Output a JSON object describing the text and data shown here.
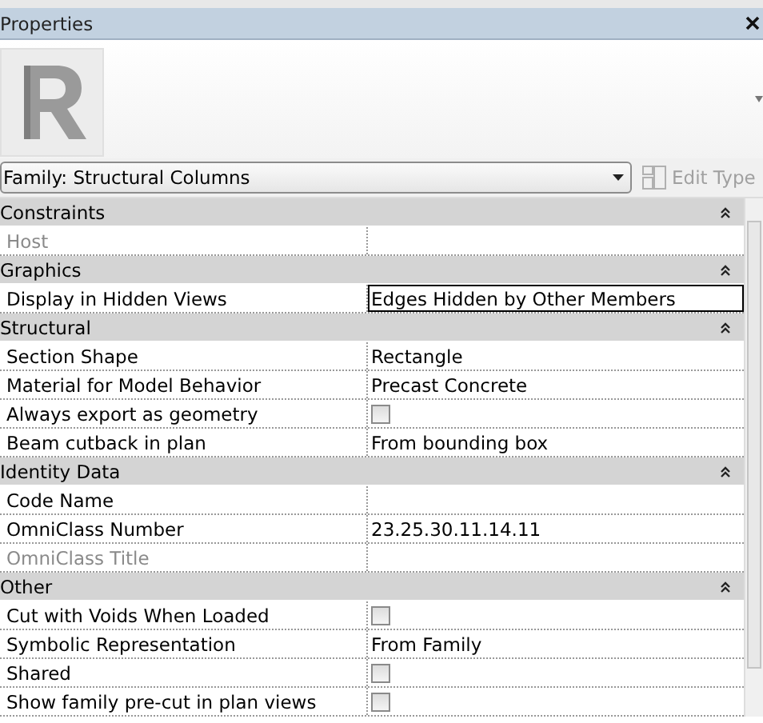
{
  "window": {
    "title": "Properties"
  },
  "type_selector": {
    "value": "Family: Structural Columns",
    "edit_type": {
      "label": "Edit Type",
      "disabled": true
    }
  },
  "sections": [
    {
      "title": "Constraints",
      "expanded": true,
      "rows": [
        {
          "kind": "text",
          "name": "Host",
          "value": "",
          "disabled": true,
          "selected": false
        }
      ]
    },
    {
      "title": "Graphics",
      "expanded": true,
      "rows": [
        {
          "kind": "text",
          "name": "Display in Hidden Views",
          "value": "Edges Hidden by Other Members",
          "disabled": false,
          "selected": true
        }
      ]
    },
    {
      "title": "Structural",
      "expanded": true,
      "rows": [
        {
          "kind": "text",
          "name": "Section Shape",
          "value": "Rectangle",
          "disabled": false,
          "selected": false
        },
        {
          "kind": "text",
          "name": "Material for Model Behavior",
          "value": "Precast Concrete",
          "disabled": false,
          "selected": false
        },
        {
          "kind": "checkbox",
          "name": "Always export as geometry",
          "checked": false,
          "disabled": false,
          "selected": false
        },
        {
          "kind": "text",
          "name": "Beam cutback in plan",
          "value": "From bounding box",
          "disabled": false,
          "selected": false
        }
      ]
    },
    {
      "title": "Identity Data",
      "expanded": true,
      "rows": [
        {
          "kind": "text",
          "name": "Code Name",
          "value": "",
          "disabled": false,
          "selected": false
        },
        {
          "kind": "text",
          "name": "OmniClass Number",
          "value": "23.25.30.11.14.11",
          "disabled": false,
          "selected": false
        },
        {
          "kind": "text",
          "name": "OmniClass Title",
          "value": "",
          "disabled": true,
          "selected": false
        }
      ]
    },
    {
      "title": "Other",
      "expanded": true,
      "rows": [
        {
          "kind": "checkbox",
          "name": "Cut with Voids When Loaded",
          "checked": false,
          "disabled": false,
          "selected": false
        },
        {
          "kind": "text",
          "name": "Symbolic Representation",
          "value": "From Family",
          "disabled": false,
          "selected": false
        },
        {
          "kind": "checkbox",
          "name": "Shared",
          "checked": false,
          "disabled": false,
          "selected": false
        },
        {
          "kind": "checkbox",
          "name": "Show family pre-cut in plan views",
          "checked": false,
          "disabled": false,
          "selected": false
        }
      ]
    }
  ]
}
